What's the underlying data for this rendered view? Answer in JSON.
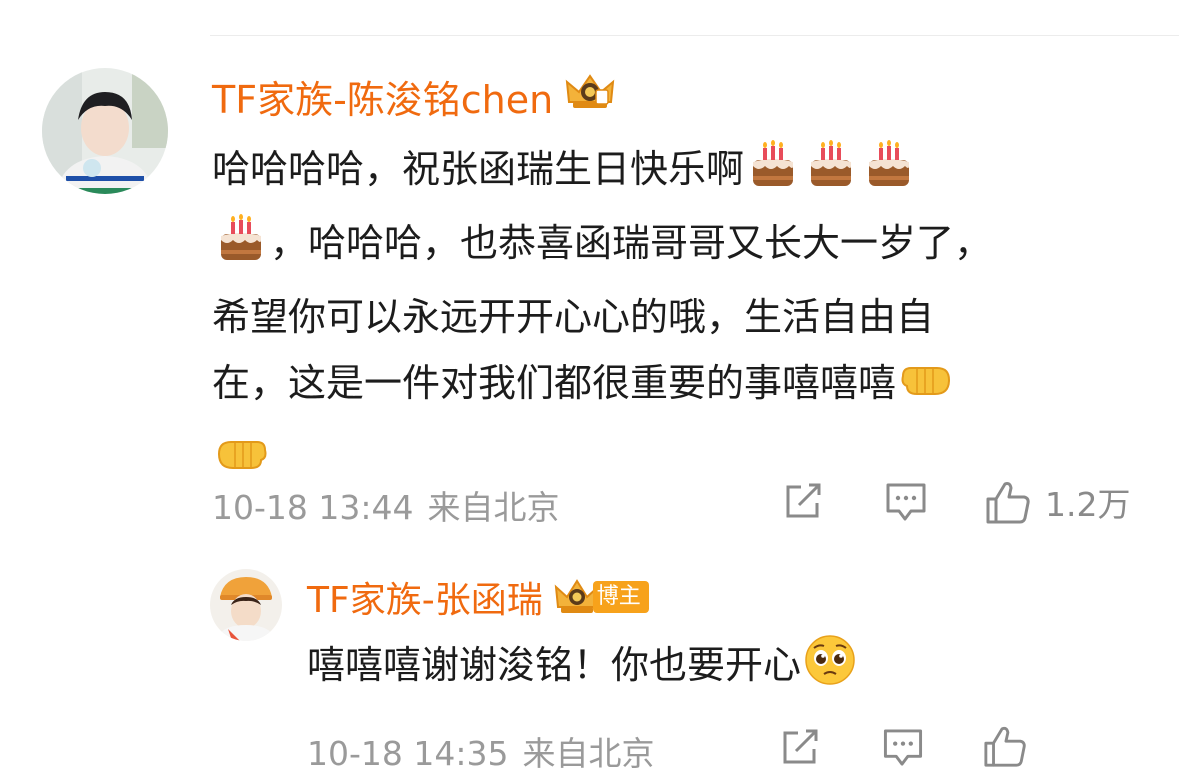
{
  "comment": {
    "username": "TF家族-陈浚铭chen",
    "text_lines": [
      "哈哈哈哈，祝张函瑞生日快乐啊",
      "，哈哈哈，也恭喜函瑞哥哥又长大一岁了，",
      "希望你可以永远开开心心的哦，生活自由自",
      "在，这是一件对我们都很重要的事嘻嘻嘻"
    ],
    "time": "10-18 13:44",
    "location": "来自北京",
    "like_count": "1.2万",
    "icons": [
      "share-icon",
      "comment-icon",
      "like-icon"
    ]
  },
  "reply": {
    "username": "TF家族-张函瑞",
    "badge": "博主",
    "text": "嘻嘻嘻谢谢浚铭！你也要开心",
    "time": "10-18 14:35",
    "location": "来自北京",
    "icons": [
      "share-icon",
      "comment-icon",
      "like-icon"
    ]
  },
  "colors": {
    "username": "#f06a0f",
    "meta": "#9a9a9a",
    "badge": "#f7a21b"
  },
  "emojis": [
    "birthday-cake",
    "left-facing-fist",
    "right-facing-fist",
    "pleading-face"
  ]
}
